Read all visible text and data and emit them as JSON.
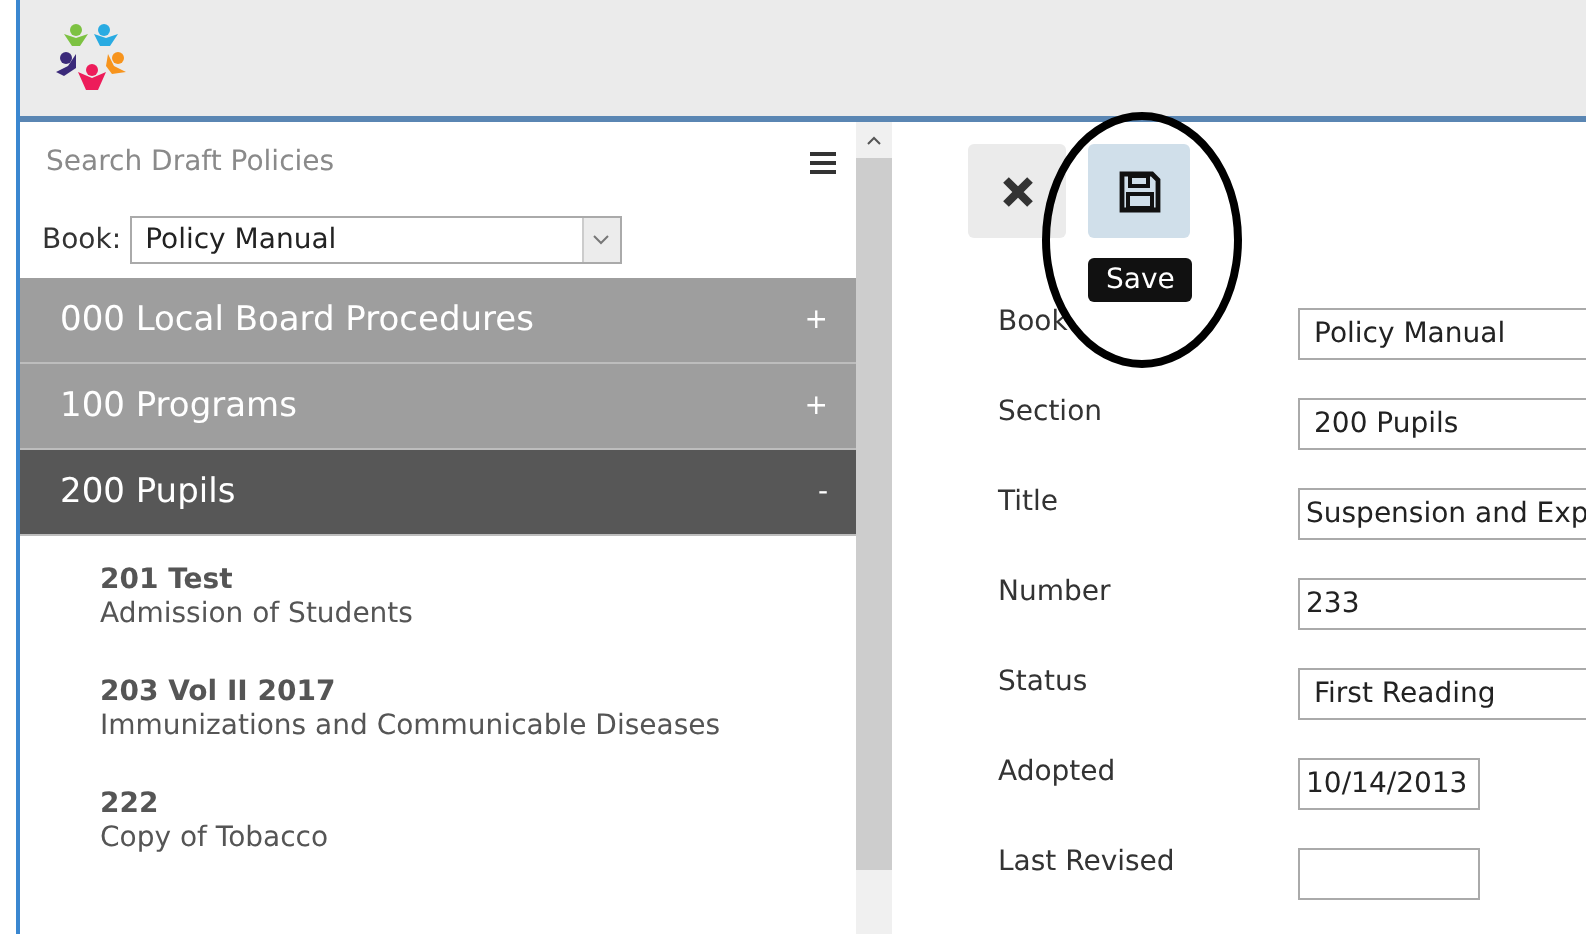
{
  "sidebar": {
    "search": {
      "placeholder": "Search Draft Policies"
    },
    "book": {
      "label": "Book:",
      "value": "Policy Manual"
    },
    "sections": [
      {
        "title": "000 Local Board Procedures",
        "toggle": "+",
        "expanded": false
      },
      {
        "title": "100 Programs",
        "toggle": "+",
        "expanded": false
      },
      {
        "title": "200 Pupils",
        "toggle": "-",
        "expanded": true,
        "items": [
          {
            "number": "201 Test",
            "title": "Admission of Students"
          },
          {
            "number": "203 Vol II 2017",
            "title": "Immunizations and Communicable Diseases"
          },
          {
            "number": "222",
            "title": "Copy of Tobacco"
          }
        ]
      }
    ]
  },
  "toolbar": {
    "tooltip": "Save"
  },
  "form": [
    {
      "label": "Book",
      "kind": "select",
      "value": "Policy Manual"
    },
    {
      "label": "Section",
      "kind": "select",
      "value": "200 Pupils"
    },
    {
      "label": "Title",
      "kind": "text",
      "value": "Suspension and Exp"
    },
    {
      "label": "Number",
      "kind": "text",
      "value": "233"
    },
    {
      "label": "Status",
      "kind": "select",
      "value": "First Reading"
    },
    {
      "label": "Adopted",
      "kind": "date",
      "value": "10/14/2013"
    },
    {
      "label": "Last Revised",
      "kind": "date"
    }
  ]
}
